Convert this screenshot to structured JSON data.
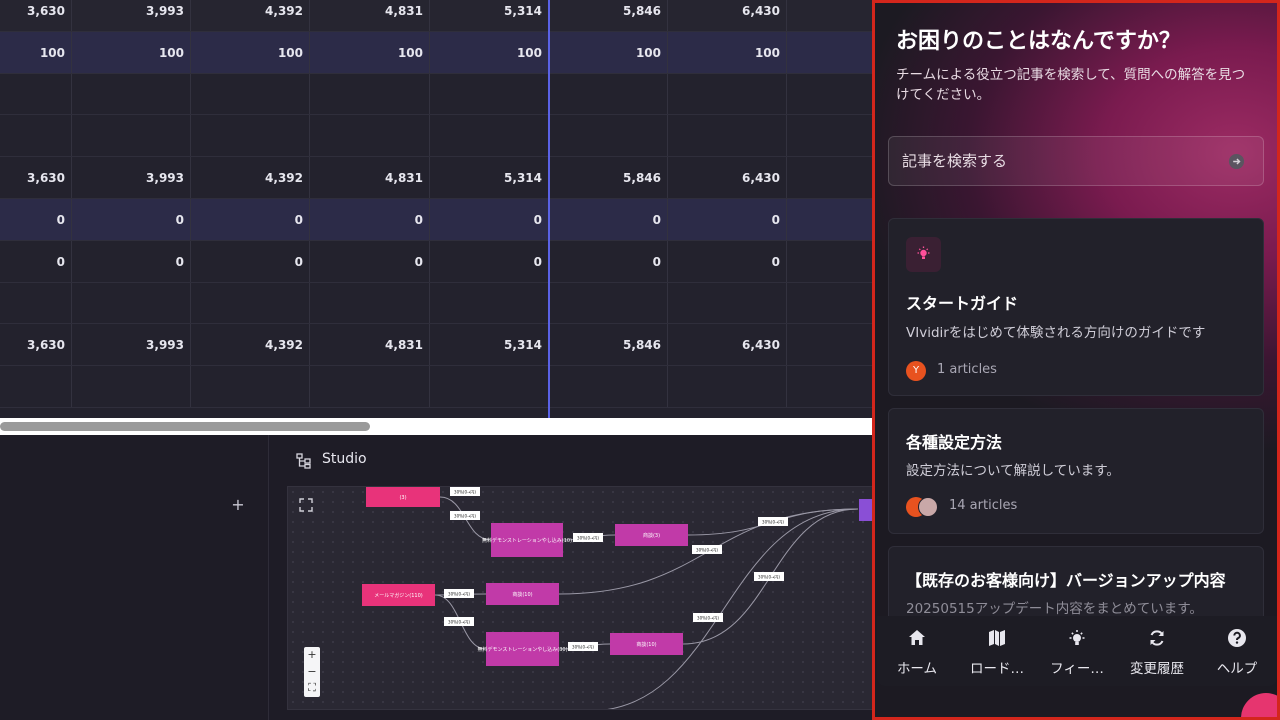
{
  "grid": {
    "rows": [
      {
        "style": "dk",
        "values": [
          "3,630",
          "3,993",
          "4,392",
          "4,831",
          "5,314",
          "5,846",
          "6,430"
        ]
      },
      {
        "style": "hl",
        "values": [
          "100",
          "100",
          "100",
          "100",
          "100",
          "100",
          "100"
        ]
      },
      {
        "style": "",
        "values": [
          "",
          "",
          "",
          "",
          "",
          "",
          ""
        ]
      },
      {
        "style": "",
        "values": [
          "",
          "",
          "",
          "",
          "",
          "",
          ""
        ]
      },
      {
        "style": "",
        "values": [
          "3,630",
          "3,993",
          "4,392",
          "4,831",
          "5,314",
          "5,846",
          "6,430"
        ]
      },
      {
        "style": "hl",
        "values": [
          "0",
          "0",
          "0",
          "0",
          "0",
          "0",
          "0"
        ]
      },
      {
        "style": "",
        "values": [
          "0",
          "0",
          "0",
          "0",
          "0",
          "0",
          "0"
        ]
      },
      {
        "style": "",
        "values": [
          "",
          "",
          "",
          "",
          "",
          "",
          ""
        ]
      },
      {
        "style": "",
        "values": [
          "3,630",
          "3,993",
          "4,392",
          "4,831",
          "5,314",
          "5,846",
          "6,430"
        ]
      },
      {
        "style": "",
        "values": [
          "",
          "",
          "",
          "",
          "",
          "",
          ""
        ]
      }
    ]
  },
  "studio": {
    "title": "Studio",
    "plus_label": "+",
    "zoom_in": "+",
    "zoom_out": "−",
    "fit": "⛶",
    "nodes": [
      {
        "label": "(3)",
        "color": "#e8337a"
      },
      {
        "label": "無料デモンストレーションやし込み(10)",
        "color": "#c13aa8"
      },
      {
        "label": "商談(3)",
        "color": "#c13aa8"
      },
      {
        "label": "メールマガジン(110)",
        "color": "#e8337a"
      },
      {
        "label": "商談(10)",
        "color": "#c13aa8"
      },
      {
        "label": "無料デモンストレーションやし込み(30)",
        "color": "#c13aa8"
      },
      {
        "label": "商談(10)",
        "color": "#c13aa8"
      }
    ],
    "edge_label": "30%(0→円)"
  },
  "help": {
    "title": "お困りのことはなんですか？",
    "subtitle": "チームによる役立つ記事を検索して、質問への解答を見つけてください。",
    "search_placeholder": "記事を検索する",
    "cards": [
      {
        "title": "スタートガイド",
        "desc": "VIvidirをはじめて体験される方向けのガイドです",
        "avatar": "Y",
        "count": "1 articles"
      },
      {
        "title": "各種設定方法",
        "desc": "設定方法について解説しています。",
        "count": "14 articles"
      },
      {
        "title": "【既存のお客様向け】バージョンアップ内容",
        "desc": "20250515アップデート内容をまとめています。"
      }
    ],
    "tabs": [
      {
        "label": "ホーム",
        "icon": "home-icon"
      },
      {
        "label": "ロード…",
        "icon": "roadmap-icon"
      },
      {
        "label": "フィー…",
        "icon": "bulb-icon"
      },
      {
        "label": "変更履歴",
        "icon": "refresh-icon"
      },
      {
        "label": "ヘルプ",
        "icon": "question-icon"
      }
    ]
  },
  "colors": {
    "accent": "#5a62e6",
    "brand": "#e6356f",
    "highlight_border": "#d3261c"
  }
}
